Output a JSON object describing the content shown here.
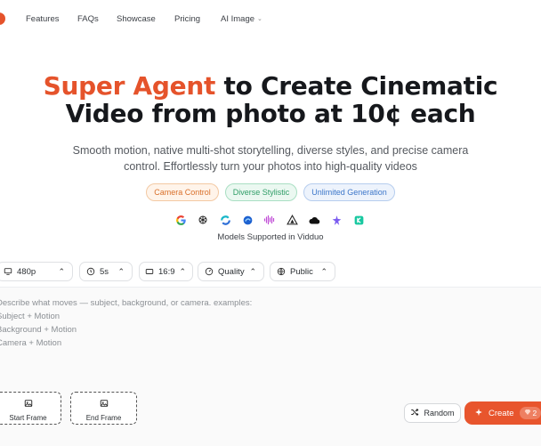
{
  "nav": {
    "items": [
      "Features",
      "FAQs",
      "Showcase",
      "Pricing",
      "AI Image"
    ]
  },
  "hero": {
    "title_accent": "Super Agent",
    "title_rest_1": " to Create Cinematic",
    "title_line_2": "Video from photo at 10¢ each",
    "subtitle": "Smooth motion, native multi-shot storytelling, diverse styles, and precise camera control. Effortlessly turn your photos into high-quality videos",
    "tags": [
      "Camera Control",
      "Diverse Stylistic",
      "Unlimited Generation"
    ],
    "models_caption": "Models Supported in Vidduo",
    "model_icons": [
      "google-icon",
      "openai-icon",
      "runway-icon",
      "hailuo-icon",
      "pixverse-icon",
      "vidu-icon",
      "cloud-icon",
      "sparkle-icon",
      "kling-icon"
    ]
  },
  "options": {
    "resolution": "480p",
    "duration": "5s",
    "ratio": "16:9",
    "quality": "Quality",
    "visibility": "Public"
  },
  "prompt": {
    "placeholder": "Describe what moves — subject, background, or camera. examples:\nSubject + Motion\nBackground + Motion\nCamera + Motion"
  },
  "frames": {
    "start": "Start Frame",
    "end": "End Frame"
  },
  "actions": {
    "random": "Random",
    "create": "Create",
    "credits": "2"
  },
  "colors": {
    "accent": "#e5532b",
    "tag_orange": "#d9702b",
    "tag_green": "#2f9d67",
    "tag_blue": "#3c76c9"
  }
}
